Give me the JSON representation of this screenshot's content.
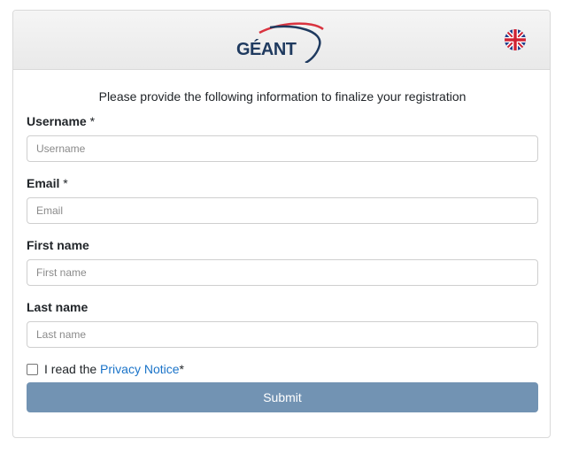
{
  "header": {
    "logo_text": "GÉANT",
    "language_icon": "uk-flag-icon"
  },
  "intro": "Please provide the following information to finalize your registration",
  "form": {
    "username": {
      "label": "Username",
      "required_mark": " *",
      "placeholder": "Username",
      "value": ""
    },
    "email": {
      "label": "Email",
      "required_mark": " *",
      "placeholder": "Email",
      "value": ""
    },
    "first_name": {
      "label": "First name",
      "placeholder": "First name",
      "value": ""
    },
    "last_name": {
      "label": "Last name",
      "placeholder": "Last name",
      "value": ""
    },
    "consent": {
      "prefix": "I read the ",
      "link_text": "Privacy Notice",
      "suffix": "*",
      "checked": false
    },
    "submit_label": "Submit"
  },
  "colors": {
    "accent": "#7293b3",
    "link": "#1a73c8",
    "logo_navy": "#1f3a5f",
    "logo_red": "#d9333f"
  }
}
